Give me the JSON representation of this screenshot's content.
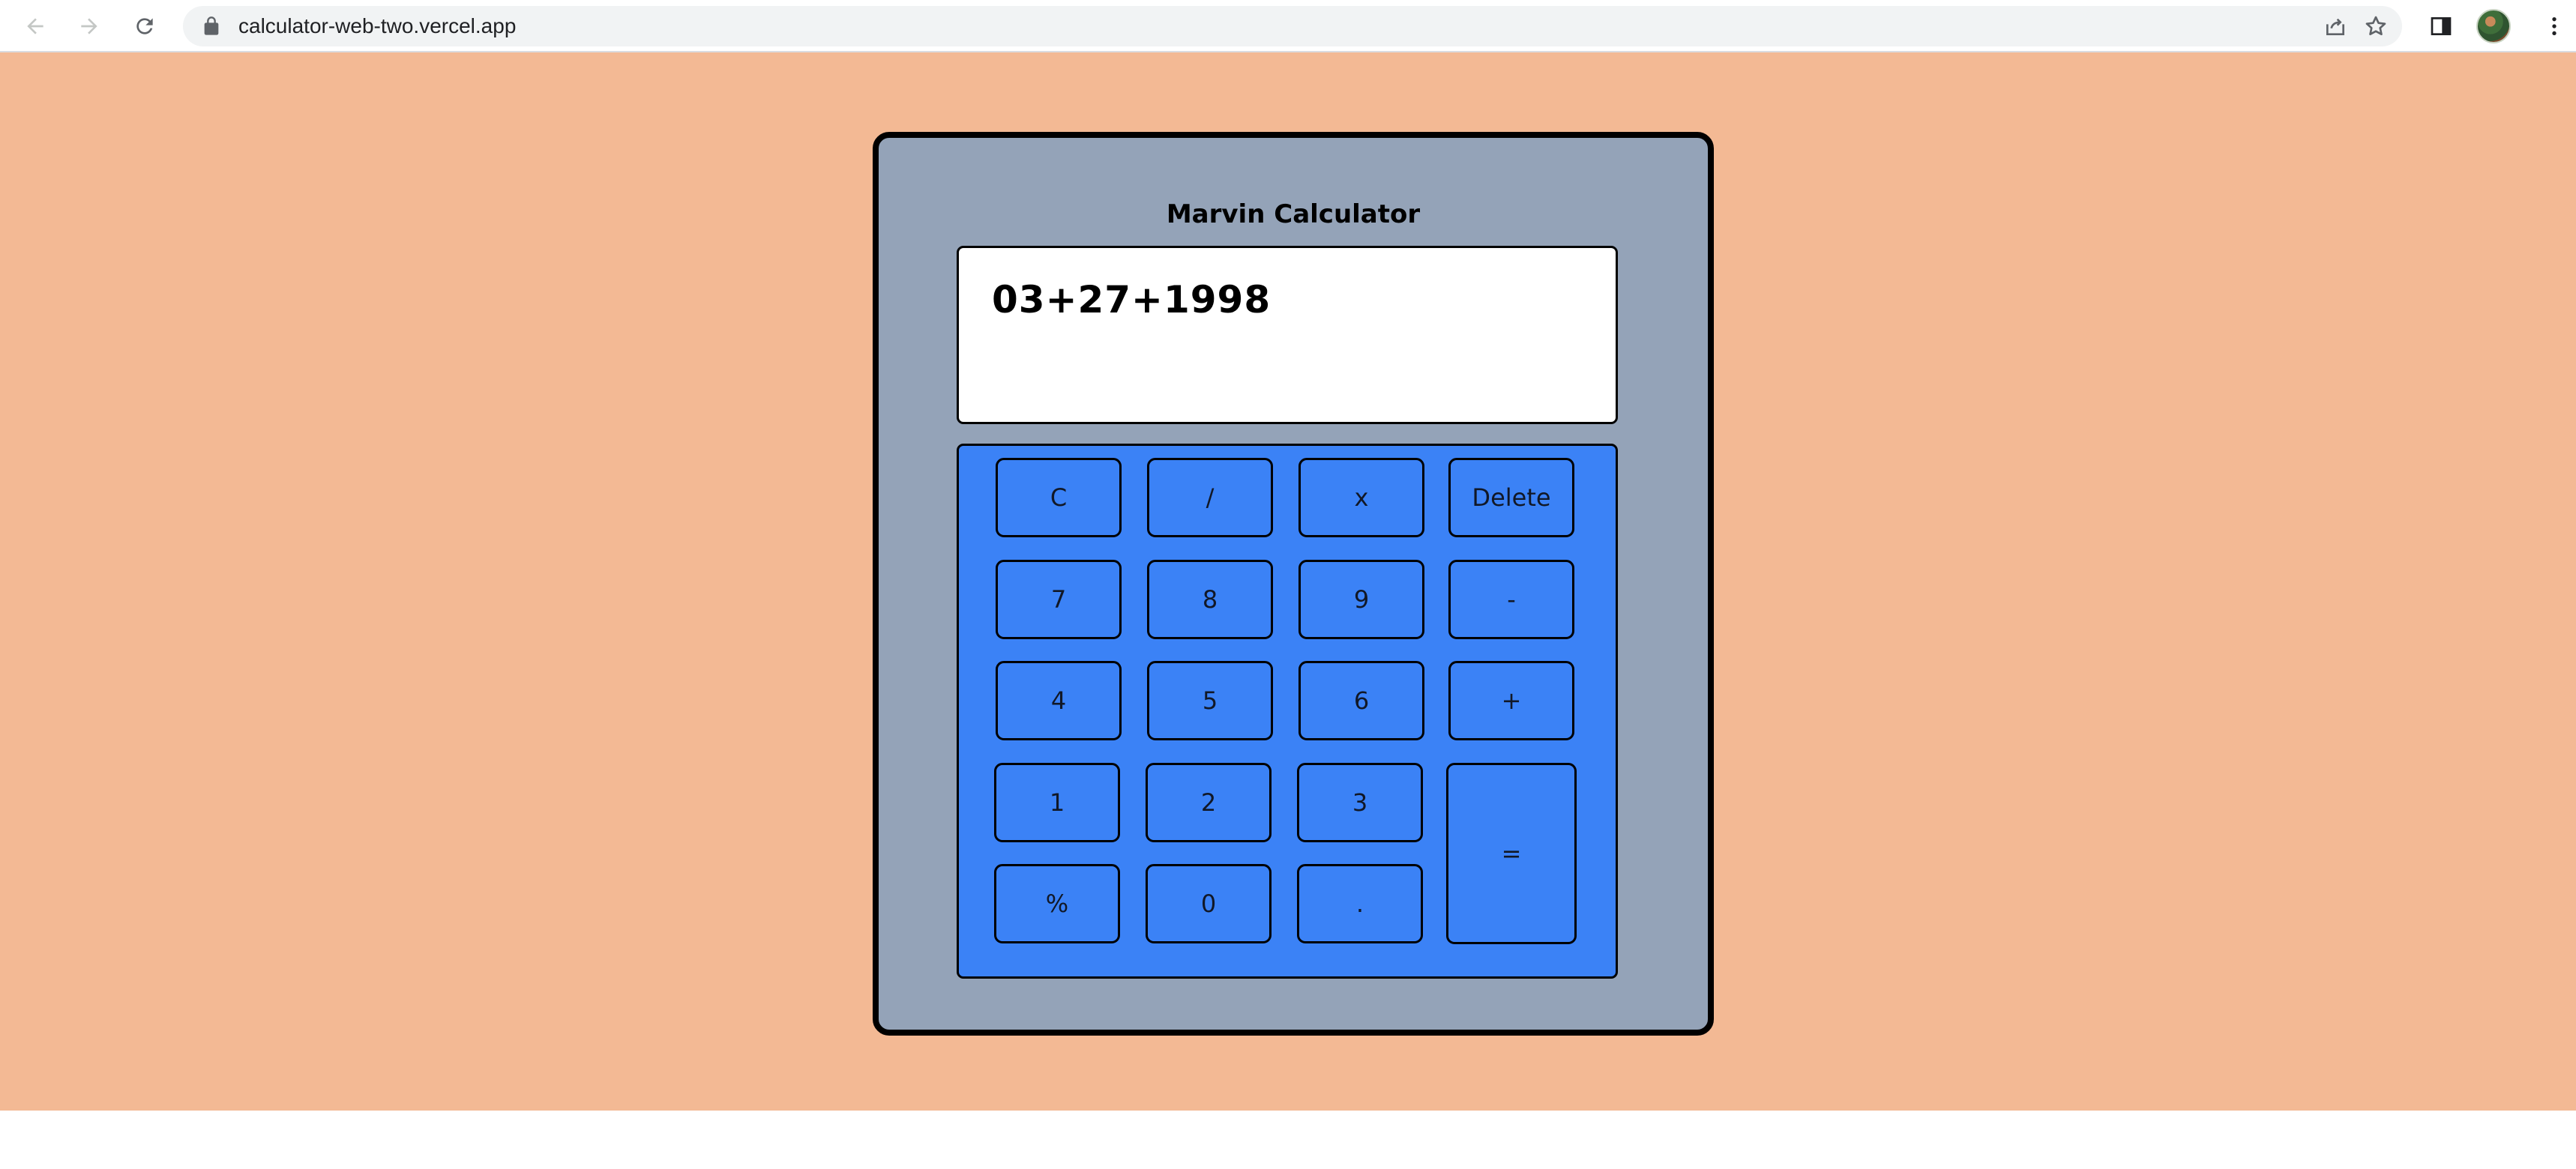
{
  "browser": {
    "url": "calculator-web-two.vercel.app",
    "icons": {
      "back": "arrow-left-icon",
      "forward": "arrow-right-icon",
      "reload": "reload-icon",
      "lock": "lock-icon",
      "share": "share-icon",
      "bookmark": "star-icon",
      "side_panel": "side-panel-icon",
      "profile": "avatar",
      "menu": "kebab-menu-icon"
    }
  },
  "calculator": {
    "title": "Marvin Calculator",
    "display": "03+27+1998",
    "keys": {
      "clear": "C",
      "divide": "/",
      "multiply": "x",
      "delete": "Delete",
      "seven": "7",
      "eight": "8",
      "nine": "9",
      "minus": "-",
      "four": "4",
      "five": "5",
      "six": "6",
      "plus": "+",
      "one": "1",
      "two": "2",
      "three": "3",
      "equals": "=",
      "percent": "%",
      "zero": "0",
      "decimal": "."
    }
  },
  "colors": {
    "page_background": "#f3b994",
    "calculator_body": "#94a3b8",
    "keypad": "#3b82f6",
    "display": "#ffffff"
  }
}
